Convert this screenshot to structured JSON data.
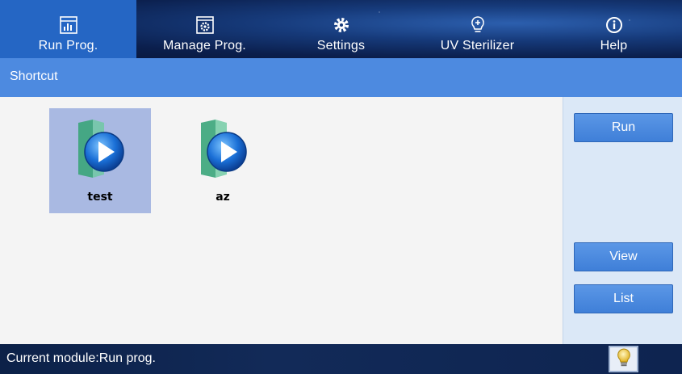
{
  "nav": {
    "tabs": [
      {
        "label": "Run Prog.",
        "icon": "chart-icon",
        "active": true
      },
      {
        "label": "Manage Prog.",
        "icon": "program-gear-icon",
        "active": false
      },
      {
        "label": "Settings",
        "icon": "gear-icon",
        "active": false
      },
      {
        "label": "UV Sterilizer",
        "icon": "uv-lamp-icon",
        "active": false
      },
      {
        "label": "Help",
        "icon": "info-icon",
        "active": false
      }
    ]
  },
  "shortcut": {
    "title": "Shortcut"
  },
  "programs": [
    {
      "name": "test",
      "selected": true
    },
    {
      "name": "az",
      "selected": false
    }
  ],
  "side": {
    "run_label": "Run",
    "view_label": "View",
    "list_label": "List"
  },
  "status": {
    "text": "Current module:Run prog."
  },
  "colors": {
    "accent": "#4d8ae0",
    "active_tab": "#2566c4",
    "selected_item": "#a9b9e2",
    "side_panel": "#dbe8f7"
  }
}
